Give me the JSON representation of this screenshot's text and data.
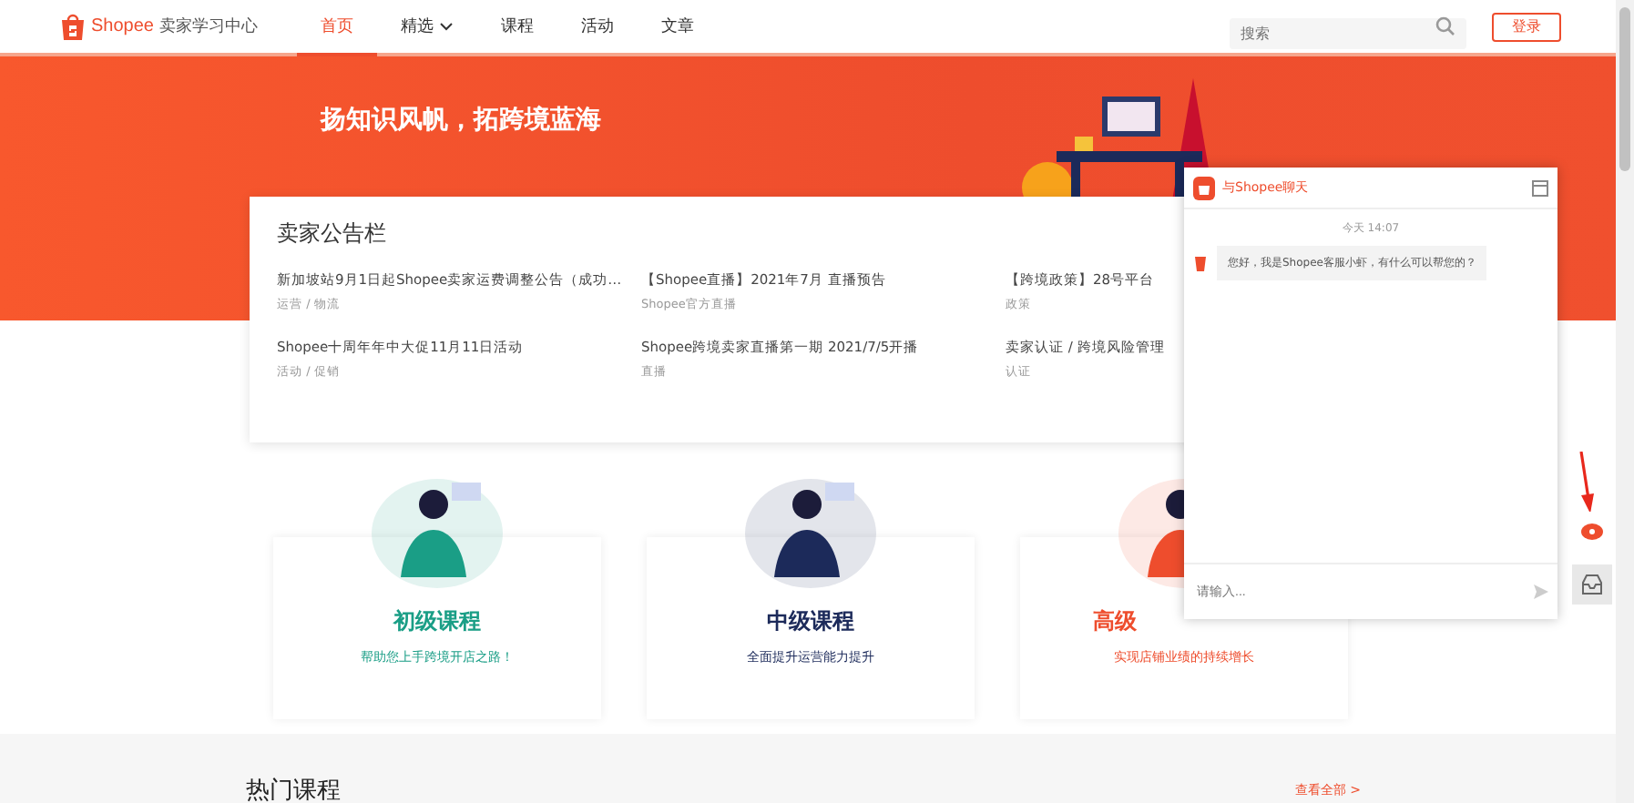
{
  "header": {
    "logo_text": "Shopee",
    "site_name": "卖家学习中心",
    "nav": [
      {
        "label": "首页",
        "selected": true,
        "has_menu": false
      },
      {
        "label": "精选",
        "selected": false,
        "has_menu": true
      },
      {
        "label": "课程",
        "selected": false,
        "has_menu": false
      },
      {
        "label": "活动",
        "selected": false,
        "has_menu": false
      },
      {
        "label": "文章",
        "selected": false,
        "has_menu": false
      }
    ],
    "search": {
      "placeholder": "搜索"
    },
    "login_button": "登录"
  },
  "banner": {
    "slogan": "扬知识风帆，拓跨境蓝海"
  },
  "notice_board": {
    "title": "卖家公告栏",
    "items": [
      {
        "title": "新加坡站9月1日起Shopee卖家运费调整公告（成功…",
        "meta": "运营 / 物流"
      },
      {
        "title": "【Shopee直播】2021年7月 直播预告",
        "meta": "Shopee官方直播"
      },
      {
        "title": "【跨境政策】28号平台",
        "meta": "政策"
      },
      {
        "title": "Shopee十周年年中大促11月11日活动",
        "meta": "活动 / 促销"
      },
      {
        "title": "Shopee跨境卖家直播第一期 2021/7/5开播",
        "meta": "直播"
      },
      {
        "title": "卖家认证 / 跨境风险管理",
        "meta": "认证"
      }
    ]
  },
  "courses": [
    {
      "title": "初级课程",
      "subtitle": "帮助您上手跨境开店之路！",
      "color": "#1a9e86"
    },
    {
      "title": "中级课程",
      "subtitle": "全面提升运营能力提升",
      "color": "#1c2a5a"
    },
    {
      "title": "高级",
      "subtitle": "实现店铺业绩的持续增长",
      "color": "#ee4d2d"
    }
  ],
  "hot_courses": {
    "title": "热门课程",
    "more_link": "查看全部 >"
  },
  "chat": {
    "title": "与Shopee聊天",
    "time": "今天 14:07",
    "message": "您好，我是Shopee客服小虾，有什么可以帮您的？",
    "input_placeholder": "请输入..."
  }
}
